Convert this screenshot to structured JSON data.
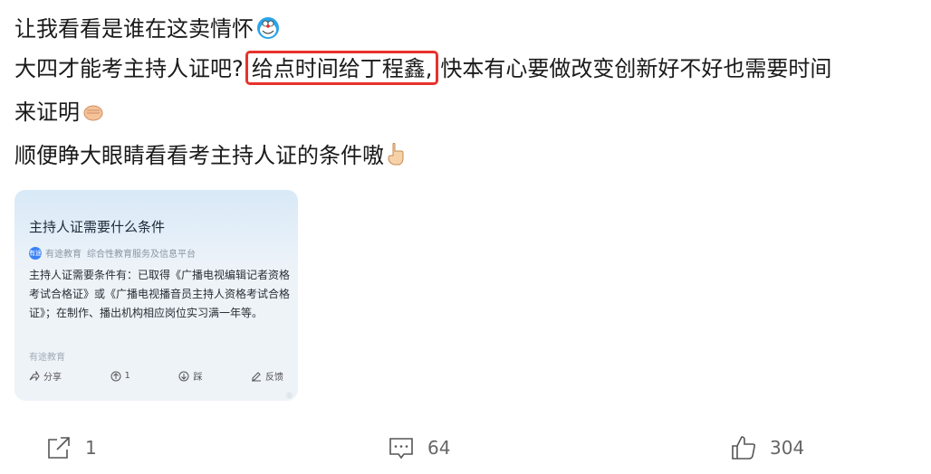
{
  "post": {
    "line1": "让我看看是谁在这卖情怀",
    "line2_pre": "大四才能考主持人证吧?",
    "line2_highlight": "给点时间给丁程鑫,",
    "line2_post": "快本有心要做改变创新好不好也需要时间",
    "line3": "来证明",
    "line4": "顺便睁大眼睛看看考主持人证的条件嗷"
  },
  "card": {
    "title": "主持人证需要什么条件",
    "source_name": "有途教育",
    "source_desc": "综合性教育服务及信息平台",
    "body": "主持人证需要条件有：已取得《广播电视编辑记者资格考试合格证》或《广播电视播音员主持人资格考试合格证》；在制作、播出机构相应岗位实习满一年等。",
    "source_footer": "有途教育",
    "actions": [
      "分享",
      "1",
      "踩",
      "反馈"
    ]
  },
  "footer": {
    "share_count": "1",
    "comment_count": "64",
    "like_count": "304"
  }
}
